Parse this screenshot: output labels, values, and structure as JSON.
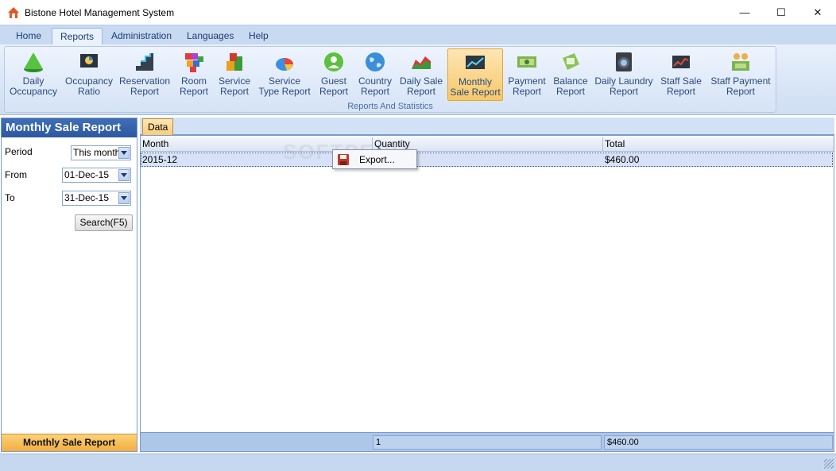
{
  "window": {
    "title": "Bistone Hotel Management System",
    "controls": {
      "minimize": "—",
      "maximize": "☐",
      "close": "✕"
    }
  },
  "menu": {
    "tabs": [
      {
        "label": "Home",
        "active": false
      },
      {
        "label": "Reports",
        "active": true
      },
      {
        "label": "Administration",
        "active": false
      },
      {
        "label": "Languages",
        "active": false
      },
      {
        "label": "Help",
        "active": false
      }
    ]
  },
  "ribbon": {
    "group_label": "Reports And Statistics",
    "buttons": [
      {
        "line1": "Daily",
        "line2": "Occupancy",
        "icon": "green-cone-icon"
      },
      {
        "line1": "Occupancy",
        "line2": "Ratio",
        "icon": "pie-monitor-icon"
      },
      {
        "line1": "Reservation",
        "line2": "Report",
        "icon": "stairs-chart-icon"
      },
      {
        "line1": "Room",
        "line2": "Report",
        "icon": "colored-blocks-icon"
      },
      {
        "line1": "Service",
        "line2": "Report",
        "icon": "cube-stack-icon"
      },
      {
        "line1": "Service",
        "line2": "Type Report",
        "icon": "pie-3d-icon"
      },
      {
        "line1": "Guest",
        "line2": "Report",
        "icon": "guest-icon"
      },
      {
        "line1": "Country",
        "line2": "Report",
        "icon": "globe-icon"
      },
      {
        "line1": "Daily Sale",
        "line2": "Report",
        "icon": "area-chart-icon"
      },
      {
        "line1": "Monthly",
        "line2": "Sale Report",
        "icon": "monthly-chart-icon",
        "active": true
      },
      {
        "line1": "Payment",
        "line2": "Report",
        "icon": "money-icon"
      },
      {
        "line1": "Balance",
        "line2": "Report",
        "icon": "calculator-icon"
      },
      {
        "line1": "Daily Laundry",
        "line2": "Report",
        "icon": "washing-machine-icon"
      },
      {
        "line1": "Staff Sale",
        "line2": "Report",
        "icon": "line-chart-icon"
      },
      {
        "line1": "Staff Payment",
        "line2": "Report",
        "icon": "staff-money-icon"
      }
    ]
  },
  "left_panel": {
    "title": "Monthly Sale Report",
    "period_label": "Period",
    "period_value": "This month",
    "from_label": "From",
    "from_value": "01-Dec-15",
    "to_label": "To",
    "to_value": "31-Dec-15",
    "search_label": "Search(F5)",
    "footer": "Monthly Sale Report"
  },
  "data_tab": {
    "label": "Data"
  },
  "grid": {
    "columns": [
      "Month",
      "Quantity",
      "Total"
    ],
    "rows": [
      {
        "month": "2015-12",
        "quantity": "",
        "total": "$460.00"
      }
    ],
    "footer": {
      "quantity": "1",
      "total": "$460.00"
    }
  },
  "context_menu": {
    "items": [
      {
        "label": "Export...",
        "icon": "floppy-disk-icon"
      }
    ]
  },
  "watermark": "SOFTPEDIA",
  "colors": {
    "accent": "#2c58a0",
    "active_orange": "#f7c868",
    "panel_border": "#7c9ac9"
  }
}
